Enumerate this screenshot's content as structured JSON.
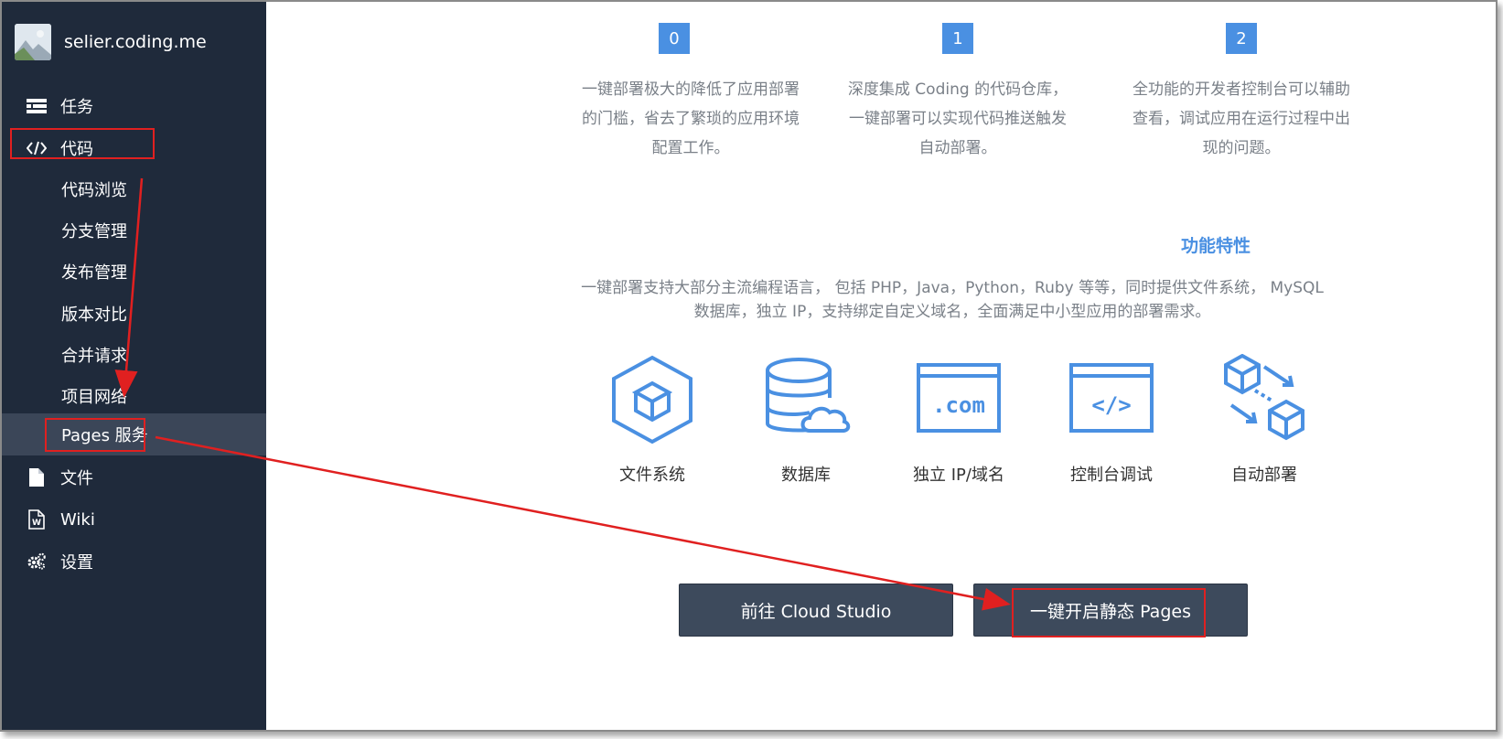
{
  "sidebar": {
    "site_name": "selier.coding.me",
    "nav": [
      {
        "label": "任务",
        "icon": "task-list-icon"
      },
      {
        "label": "代码",
        "icon": "code-icon"
      },
      {
        "label": "文件",
        "icon": "file-icon"
      },
      {
        "label": "Wiki",
        "icon": "wiki-icon"
      },
      {
        "label": "设置",
        "icon": "gear-icon"
      }
    ],
    "sub_items": [
      "代码浏览",
      "分支管理",
      "发布管理",
      "版本对比",
      "合并请求",
      "项目网络",
      "Pages 服务"
    ],
    "active_sub_item": "Pages 服务"
  },
  "steps": [
    {
      "num": "0",
      "desc_lines": [
        "一键部署极大的降低了应用部署",
        "的门槛，省去了繁琐的应用环境",
        "配置工作。"
      ]
    },
    {
      "num": "1",
      "desc_lines": [
        "深度集成 Coding 的代码仓库，",
        "一键部署可以实现代码推送触发",
        "自动部署。"
      ]
    },
    {
      "num": "2",
      "desc_lines": [
        "全功能的开发者控制台可以辅助",
        "查看，调试应用在运行过程中出",
        "现的问题。"
      ]
    }
  ],
  "features": {
    "title": "功能特性",
    "desc_lines": [
      "一键部署支持大部分主流编程语言， 包括 PHP，Java，Python，Ruby 等等，同时提供文件系统， MySQL",
      "数据库，独立 IP，支持绑定自定义域名，全面满足中小型应用的部署需求。"
    ],
    "items": [
      {
        "label": "文件系统",
        "icon": "cube-hexagon-icon"
      },
      {
        "label": "数据库",
        "icon": "database-cloud-icon"
      },
      {
        "label": "独立 IP/域名",
        "icon": "dotcom-window-icon",
        "icon_text": ".com"
      },
      {
        "label": "控制台调试",
        "icon": "code-window-icon",
        "icon_text": "</>"
      },
      {
        "label": "自动部署",
        "icon": "cubes-deploy-icon"
      }
    ]
  },
  "buttons": {
    "cloud_studio": "前往 Cloud Studio",
    "enable_pages": "一键开启静态 Pages"
  },
  "colors": {
    "sidebar_bg": "#1f2a3b",
    "sidebar_active": "#3b4658",
    "accent": "#4a90e2",
    "button_bg": "#3d4a5c",
    "annotation_red": "#e02020"
  }
}
